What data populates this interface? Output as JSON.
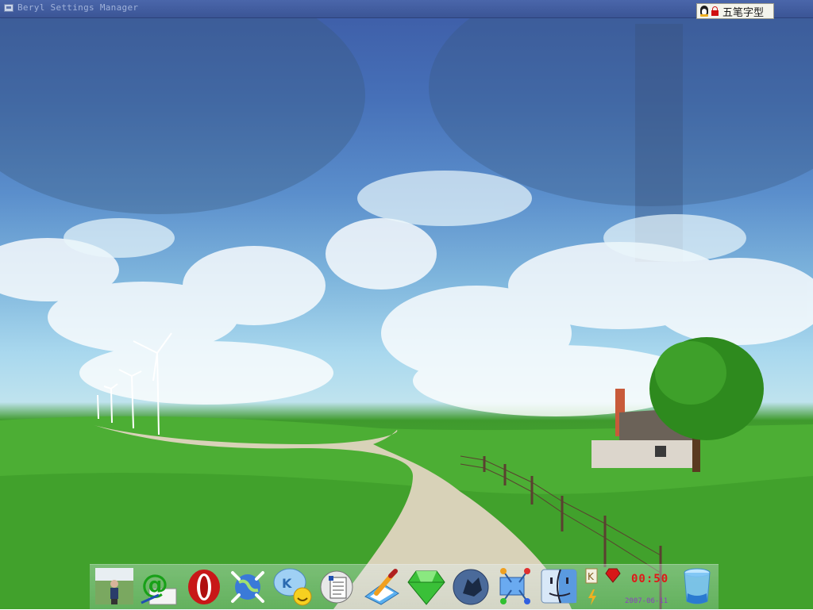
{
  "window": {
    "title": "Beryl Settings Manager"
  },
  "ime": {
    "label": "五笔字型",
    "icons": [
      "penguin-icon",
      "lock-icon"
    ]
  },
  "dock": {
    "items": [
      {
        "name": "photo-avatar",
        "icon": "person-photo-icon"
      },
      {
        "name": "mail",
        "icon": "at-mail-icon"
      },
      {
        "name": "opera",
        "icon": "opera-icon"
      },
      {
        "name": "network-globe",
        "icon": "globe-icon"
      },
      {
        "name": "messenger",
        "icon": "chat-bubble-icon"
      },
      {
        "name": "documents",
        "icon": "document-icon"
      },
      {
        "name": "text-editor",
        "icon": "pencil-icon"
      },
      {
        "name": "gem",
        "icon": "emerald-icon"
      },
      {
        "name": "wolf",
        "icon": "wolf-icon"
      },
      {
        "name": "network",
        "icon": "network-icon"
      },
      {
        "name": "finder",
        "icon": "finder-face-icon"
      },
      {
        "name": "trash",
        "icon": "trash-icon"
      }
    ],
    "clock": "00:50",
    "date": "2007-06-11"
  },
  "colors": {
    "titlebar": "#3b5596",
    "clock": "#e01818",
    "date": "#8a3fc0",
    "grass": "#4caa33",
    "sky": "#5b8fcc"
  }
}
